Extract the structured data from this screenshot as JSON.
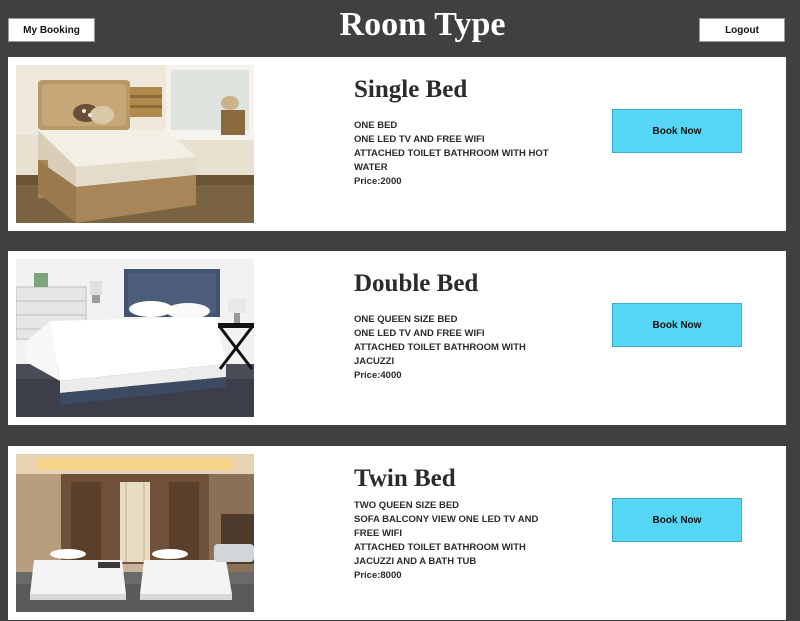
{
  "header": {
    "title": "Room Type",
    "my_booking_label": "My Booking",
    "logout_label": "Logout"
  },
  "rooms": [
    {
      "name": "Single Bed",
      "features": [
        "ONE BED",
        "ONE LED TV AND FREE WIFI",
        "ATTACHED TOILET BATHROOM WITH HOT WATER"
      ],
      "price": "Price:2000",
      "button_label": "Book Now"
    },
    {
      "name": "Double Bed",
      "features": [
        "ONE QUEEN SIZE BED",
        "ONE LED TV AND FREE WIFI",
        "ATTACHED TOILET BATHROOM WITH JACUZZI"
      ],
      "price": "Price:4000",
      "button_label": "Book Now"
    },
    {
      "name": "Twin Bed",
      "features": [
        "TWO QUEEN SIZE BED",
        "SOFA BALCONY VIEW ONE LED TV AND FREE WIFI",
        "ATTACHED TOILET BATHROOM WITH JACUZZI AND A BATH TUB"
      ],
      "price": "Price:8000",
      "button_label": "Book Now"
    }
  ],
  "colors": {
    "background": "#404040",
    "card": "#ffffff",
    "book_button": "#55d6f5",
    "text": "#2b2b2b"
  }
}
